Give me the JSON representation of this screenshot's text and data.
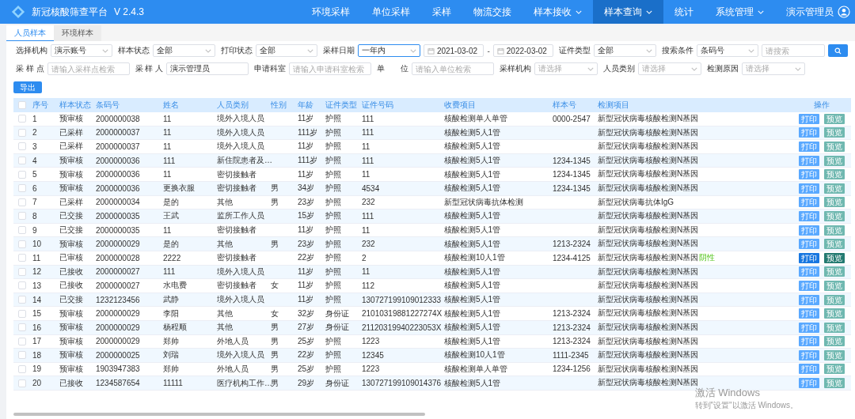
{
  "app": {
    "title": "新冠核酸筛查平台",
    "version": "V 2.4.3"
  },
  "nav": [
    {
      "label": "环境采样",
      "dropdown": false,
      "selected": false
    },
    {
      "label": "单位采样",
      "dropdown": false,
      "selected": false
    },
    {
      "label": "采样",
      "dropdown": false,
      "selected": false
    },
    {
      "label": "物流交接",
      "dropdown": false,
      "selected": false
    },
    {
      "label": "样本接收",
      "dropdown": true,
      "selected": false
    },
    {
      "label": "样本查询",
      "dropdown": true,
      "selected": true
    },
    {
      "label": "统计",
      "dropdown": false,
      "selected": false
    },
    {
      "label": "系统管理",
      "dropdown": true,
      "selected": false
    }
  ],
  "user": {
    "name": "演示管理员"
  },
  "tabs": [
    {
      "label": "人员样本",
      "selected": true
    },
    {
      "label": "环境样本",
      "selected": false
    }
  ],
  "filters": [
    [
      {
        "label": "选择机构",
        "kind": "select",
        "value": "演示账号",
        "focused": false
      },
      {
        "label": "样本状态",
        "kind": "select",
        "value": "全部",
        "focused": false
      },
      {
        "label": "打印状态",
        "kind": "select",
        "value": "全部",
        "focused": false
      },
      {
        "label": "采样日期",
        "kind": "select",
        "value": "一年内",
        "focused": true
      },
      {
        "kind": "date",
        "value": "2021-03-02"
      },
      {
        "kind": "dash",
        "value": "-"
      },
      {
        "kind": "date",
        "value": "2022-03-02"
      },
      {
        "label": "证件类型",
        "kind": "select",
        "value": "全部",
        "focused": false
      },
      {
        "label": "搜索条件",
        "kind": "select",
        "value": "条码号",
        "focused": false
      },
      {
        "kind": "input",
        "placeholder": "请搜索"
      },
      {
        "kind": "search_button"
      }
    ],
    [
      {
        "label": "采 样 点",
        "kind": "input",
        "placeholder": "请输入采样点检索"
      },
      {
        "label": "采 样 人",
        "kind": "input",
        "value": "演示管理员"
      },
      {
        "label": "申请科室",
        "kind": "input",
        "placeholder": "请输入申请科室检索"
      },
      {
        "label": "单　　位",
        "kind": "input",
        "placeholder": "请输入单位检索"
      },
      {
        "label": "采样机构",
        "kind": "select",
        "placeholder": "请选择",
        "focused": false
      },
      {
        "label": "人员类别",
        "kind": "select",
        "placeholder": "请选择",
        "focused": false
      },
      {
        "label": "检测原因",
        "kind": "select",
        "placeholder": "请选择",
        "focused": false
      }
    ]
  ],
  "export_button": "导出",
  "table": {
    "select_all_checked": false,
    "columns": [
      "序号",
      "样本状态",
      "条码号",
      "姓名",
      "人员类别",
      "性别",
      "年龄",
      "证件类型",
      "证件号码",
      "收费项目",
      "样本号",
      "检测项目"
    ],
    "actions_header": "操作",
    "rows": [
      {
        "checked": false,
        "selected": false,
        "cells": {
          "no": "1",
          "status": "预审核",
          "barcode": "2000000038",
          "name": "11",
          "category": "境外入境人员",
          "age": "11岁",
          "id_type": "护照",
          "id_no": "111",
          "fee_item": "核酸检测单人单管",
          "sample_no": "0000-2547",
          "test_item": "新型冠状病毒核酸检测N基因"
        },
        "actions": [
          "打印",
          "预览"
        ]
      },
      {
        "checked": false,
        "selected": false,
        "cells": {
          "no": "2",
          "status": "已采样",
          "barcode": "2000000037",
          "name": "11",
          "category": "境外入境人员",
          "age": "111岁",
          "id_type": "护照",
          "id_no": "111",
          "fee_item": "核酸检测5人1管",
          "test_item": "新型冠状病毒核酸检测N基因"
        },
        "actions": [
          "打印",
          "预览"
        ]
      },
      {
        "checked": false,
        "selected": false,
        "cells": {
          "no": "3",
          "status": "已采样",
          "barcode": "2000000037",
          "name": "11",
          "category": "境外入境人员",
          "age": "11岁",
          "id_type": "护照",
          "id_no": "11",
          "fee_item": "核酸检测5人1管",
          "test_item": "新型冠状病毒核酸检测N基因"
        },
        "actions": [
          "打印",
          "预览"
        ]
      },
      {
        "checked": false,
        "selected": false,
        "cells": {
          "no": "4",
          "status": "预审核",
          "barcode": "2000000036",
          "name": "111",
          "category": "新住院患者及…",
          "age": "111岁",
          "id_type": "护照",
          "id_no": "111",
          "fee_item": "核酸检测5人1管",
          "sample_no": "1234-1345",
          "test_item": "新型冠状病毒核酸检测N基因"
        },
        "actions": [
          "打印",
          "预览"
        ]
      },
      {
        "checked": false,
        "selected": false,
        "cells": {
          "no": "5",
          "status": "预审核",
          "barcode": "2000000036",
          "name": "11",
          "category": "密切接触者",
          "age": "11岁",
          "id_type": "护照",
          "id_no": "11",
          "fee_item": "核酸检测5人1管",
          "sample_no": "1234-1345",
          "test_item": "新型冠状病毒核酸检测N基因"
        },
        "actions": [
          "打印",
          "预览"
        ]
      },
      {
        "checked": false,
        "selected": false,
        "cells": {
          "no": "6",
          "status": "预审核",
          "barcode": "2000000036",
          "name": "更换衣服",
          "category": "密切接触者",
          "sex": "男",
          "age": "34岁",
          "id_type": "护照",
          "id_no": "4534",
          "fee_item": "核酸检测5人1管",
          "sample_no": "1234-1345",
          "test_item": "新型冠状病毒核酸检测N基因"
        },
        "actions": [
          "打印",
          "预览"
        ]
      },
      {
        "checked": false,
        "selected": false,
        "cells": {
          "no": "7",
          "status": "已采样",
          "barcode": "2000000034",
          "name": "是的",
          "category": "其他",
          "sex": "男",
          "age": "23岁",
          "id_type": "护照",
          "id_no": "232",
          "fee_item": "新型冠状病毒抗体检测",
          "test_item": "新型冠状病毒抗体IgG"
        },
        "actions": [
          "打印",
          "预览"
        ]
      },
      {
        "checked": false,
        "selected": false,
        "cells": {
          "no": "8",
          "status": "已交接",
          "barcode": "2000000035",
          "name": "王武",
          "category": "监所工作人员",
          "age": "15岁",
          "id_type": "护照",
          "id_no": "111",
          "fee_item": "核酸检测5人1管",
          "test_item": "新型冠状病毒核酸检测N基因"
        },
        "actions": [
          "打印",
          "预览"
        ]
      },
      {
        "checked": false,
        "selected": false,
        "cells": {
          "no": "9",
          "status": "已交接",
          "barcode": "2000000035",
          "name": "11",
          "category": "密切接触者",
          "age": "11岁",
          "id_type": "护照",
          "id_no": "11",
          "fee_item": "核酸检测5人1管",
          "test_item": "新型冠状病毒核酸检测N基因"
        },
        "actions": [
          "打印",
          "预览"
        ]
      },
      {
        "checked": false,
        "selected": false,
        "cells": {
          "no": "10",
          "status": "预审核",
          "barcode": "2000000029",
          "name": "是的",
          "category": "其他",
          "sex": "男",
          "age": "23岁",
          "id_type": "护照",
          "id_no": "232",
          "fee_item": "核酸检测5人1管",
          "sample_no": "1213-2324",
          "test_item": "新型冠状病毒核酸检测N基因"
        },
        "actions": [
          "打印",
          "预览"
        ]
      },
      {
        "checked": false,
        "selected": true,
        "cells": {
          "no": "11",
          "status": "已审核",
          "barcode": "2000000028",
          "name": "2222",
          "category": "密切接触者",
          "age": "22岁",
          "id_type": "护照",
          "id_no": "2",
          "fee_item": "核酸检测10人1管",
          "sample_no": "1234-4125",
          "test_item": "新型冠状病毒核酸检测N基因",
          "result": "阴性"
        },
        "actions": [
          "打印",
          "预览"
        ]
      },
      {
        "checked": false,
        "selected": false,
        "cells": {
          "no": "12",
          "status": "已接收",
          "barcode": "2000000027",
          "name": "111",
          "category": "境外入境人员",
          "age": "11岁",
          "id_type": "护照",
          "id_no": "11",
          "fee_item": "核酸检测5人1管",
          "test_item": "新型冠状病毒核酸检测N基因"
        },
        "actions": [
          "打印",
          "预览"
        ]
      },
      {
        "checked": false,
        "selected": false,
        "cells": {
          "no": "13",
          "status": "已接收",
          "barcode": "2000000027",
          "name": "水电费",
          "category": "密切接触者",
          "sex": "女",
          "age": "11岁",
          "id_type": "护照",
          "id_no": "112",
          "fee_item": "核酸检测5人1管",
          "test_item": "新型冠状病毒核酸检测N基因"
        },
        "actions": [
          "打印",
          "预览"
        ]
      },
      {
        "checked": false,
        "selected": false,
        "cells": {
          "no": "14",
          "status": "已交接",
          "barcode": "1232123456",
          "name": "武静",
          "category": "境外入境人员",
          "age": "11岁",
          "id_type": "护照",
          "id_no": "130727199109012333",
          "fee_item": "核酸检测5人1管",
          "test_item": "新型冠状病毒核酸检测N基因"
        },
        "actions": [
          "打印",
          "预览"
        ]
      },
      {
        "checked": false,
        "selected": false,
        "cells": {
          "no": "15",
          "status": "预审核",
          "barcode": "2000000029",
          "name": "李阳",
          "category": "其他",
          "sex": "女",
          "age": "32岁",
          "id_type": "身份证",
          "id_no": "21010319881227274X",
          "fee_item": "核酸检测5人1管",
          "sample_no": "1213-2324",
          "test_item": "新型冠状病毒核酸检测N基因"
        },
        "actions": [
          "打印",
          "预览"
        ]
      },
      {
        "checked": false,
        "selected": false,
        "cells": {
          "no": "16",
          "status": "预审核",
          "barcode": "2000000029",
          "name": "杨程顺",
          "category": "其他",
          "sex": "男",
          "age": "27岁",
          "id_type": "身份证",
          "id_no": "21120319940223053X",
          "fee_item": "核酸检测5人1管",
          "sample_no": "1213-2324",
          "test_item": "新型冠状病毒核酸检测N基因"
        },
        "actions": [
          "打印",
          "预览"
        ]
      },
      {
        "checked": false,
        "selected": false,
        "cells": {
          "no": "17",
          "status": "预审核",
          "barcode": "2000000029",
          "name": "郑帅",
          "category": "外地人员",
          "sex": "男",
          "age": "25岁",
          "id_type": "护照",
          "id_no": "1223",
          "fee_item": "核酸检测5人1管",
          "sample_no": "1213-2324",
          "test_item": "新型冠状病毒核酸检测N基因"
        },
        "actions": [
          "打印",
          "预览"
        ]
      },
      {
        "checked": false,
        "selected": false,
        "cells": {
          "no": "18",
          "status": "预审核",
          "barcode": "2000000025",
          "name": "刘瑞",
          "category": "境外入境人员",
          "sex": "男",
          "age": "22岁",
          "id_type": "护照",
          "id_no": "12345",
          "fee_item": "核酸检测10人1管",
          "sample_no": "1111-2345",
          "test_item": "新型冠状病毒核酸检测N基因"
        },
        "actions": [
          "打印",
          "预览"
        ]
      },
      {
        "checked": false,
        "selected": false,
        "cells": {
          "no": "19",
          "status": "预审核",
          "barcode": "1903947383",
          "name": "郑帅",
          "category": "外地人员",
          "sex": "男",
          "age": "25岁",
          "id_type": "护照",
          "id_no": "1223",
          "fee_item": "核酸检测单人单管",
          "sample_no": "1234-1256",
          "test_item": "新型冠状病毒核酸检测N基因"
        },
        "actions": [
          "打印",
          "预览"
        ]
      },
      {
        "checked": false,
        "selected": false,
        "cells": {
          "no": "20",
          "status": "已接收",
          "barcode": "1234587654",
          "name": "11111",
          "category": "医疗机构工作…",
          "sex": "男",
          "age": "29岁",
          "id_type": "身份证",
          "id_no": "130727199109014376",
          "fee_item": "核酸检测5人1管",
          "test_item": "新型冠状病毒核酸检测N基因"
        },
        "actions": [
          "打印",
          "预览"
        ]
      }
    ]
  },
  "os_notice": {
    "title": "激活 Windows",
    "text": "转到\"设置\"以激活 Windows。"
  }
}
